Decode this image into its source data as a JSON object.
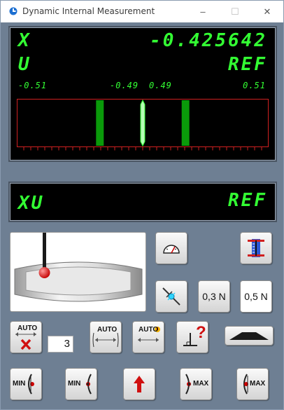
{
  "window": {
    "title": "Dynamic Internal Measurement",
    "controls": {
      "minimize": "–",
      "maximize": "☐",
      "close": "✕"
    }
  },
  "main_display": {
    "axis_label": "X",
    "value": "-0.425642",
    "sub_label": "U",
    "ref_label": "REF",
    "scale": {
      "min_left": "-0.51",
      "inner_left": "-0.49",
      "inner_right": "0.49",
      "max_right": "0.51"
    },
    "pointer_position_fraction": 0.5,
    "tolerance_left_fraction": 0.33,
    "tolerance_right_fraction": 0.67,
    "color": "#33ff33"
  },
  "secondary_display": {
    "label": "XU",
    "ref_label": "REF"
  },
  "controls": {
    "force_low": "0,3 N",
    "force_high": "0,5 N",
    "count_value": "3",
    "auto_text": "AUTO",
    "min_text": "MIN",
    "max_text": "MAX",
    "question_mark": "?"
  },
  "icons": [
    "app-icon",
    "gauge-icon",
    "calibration-icon",
    "probe-touch-icon",
    "probe-image",
    "auto-cancel-icon",
    "auto-measure-icon",
    "auto-alert-icon",
    "perpendicular-question-icon",
    "profile-icon",
    "min-left-icon",
    "min-right-icon",
    "up-arrow-icon",
    "max-left-icon",
    "max-right-icon"
  ]
}
